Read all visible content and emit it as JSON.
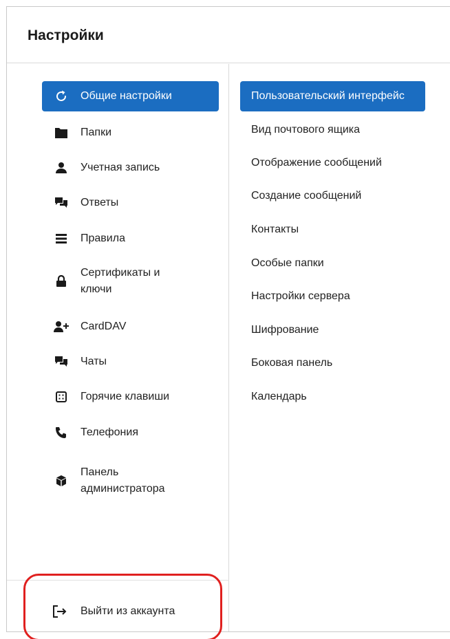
{
  "header": {
    "title": "Настройки"
  },
  "nav": {
    "items": [
      {
        "label": "Общие настройки",
        "icon": "general-settings-icon",
        "active": true
      },
      {
        "label": "Папки",
        "icon": "folder-icon"
      },
      {
        "label": "Учетная запись",
        "icon": "user-icon"
      },
      {
        "label": "Ответы",
        "icon": "replies-icon"
      },
      {
        "label": "Правила",
        "icon": "rules-icon"
      },
      {
        "label": "Сертификаты и ключи",
        "icon": "lock-icon"
      },
      {
        "label": "CardDAV",
        "icon": "add-user-icon"
      },
      {
        "label": "Чаты",
        "icon": "chat-icon"
      },
      {
        "label": "Горячие клавиши",
        "icon": "keyboard-icon"
      },
      {
        "label": "Телефония",
        "icon": "phone-icon"
      },
      {
        "label": "Панель администратора",
        "icon": "admin-cube-icon"
      }
    ],
    "logout_label": "Выйти из аккаунта"
  },
  "subnav": {
    "items": [
      {
        "label": "Пользовательский интерфейс",
        "active": true
      },
      {
        "label": "Вид почтового ящика"
      },
      {
        "label": "Отображение сообщений"
      },
      {
        "label": "Создание сообщений"
      },
      {
        "label": "Контакты"
      },
      {
        "label": "Особые папки"
      },
      {
        "label": "Настройки сервера"
      },
      {
        "label": "Шифрование"
      },
      {
        "label": "Боковая панель"
      },
      {
        "label": "Календарь"
      }
    ]
  },
  "colors": {
    "accent": "#1b6dc1",
    "highlight": "#e0201f",
    "border": "#d9d9d9"
  }
}
